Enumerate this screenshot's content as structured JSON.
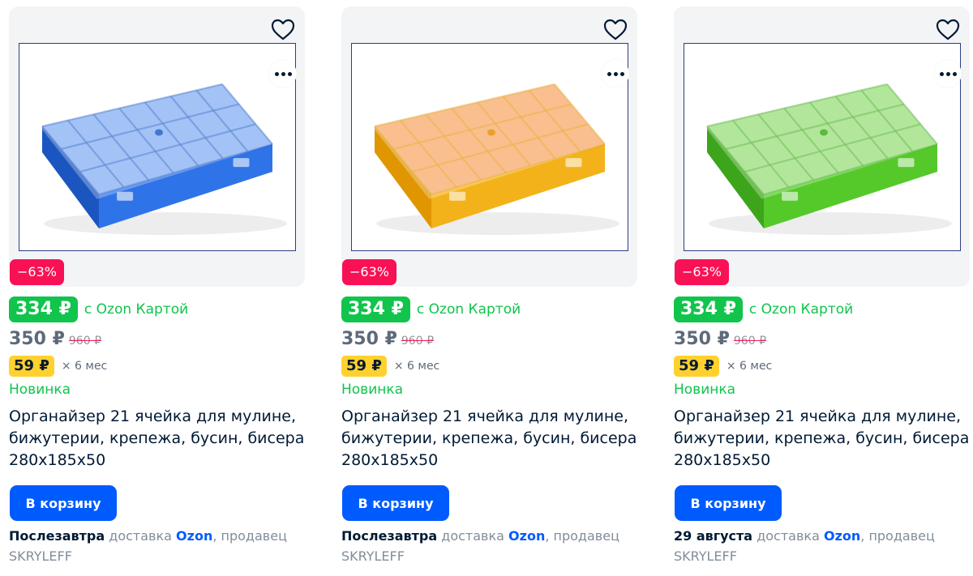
{
  "products": [
    {
      "color": "#2f73e8",
      "color_light": "#79a8f3",
      "color_dark": "#1b55bf",
      "discount": "−63%",
      "card_price": "334 ₽",
      "card_label": "с Ozon Картой",
      "price": "350 ₽",
      "old_price": "960 ₽",
      "installment": "59 ₽",
      "months": "× 6 мес",
      "badge_new": "Новинка",
      "title": "Органайзер 21 ячейка для мулине, бижутерии, крепежа, бусин, бисера 280х185х50",
      "cart_button": "В корзину",
      "delivery_day": "Послезавтра",
      "delivery_text": "доставка",
      "delivery_brand": "Ozon",
      "seller_text": ", продавец",
      "seller": "SKRYLEFF",
      "icons": {
        "favorite": "heart-icon",
        "more": "more-dots-icon"
      }
    },
    {
      "color": "#f4b21a",
      "color_light": "#f9a15a",
      "color_dark": "#e09600",
      "discount": "−63%",
      "card_price": "334 ₽",
      "card_label": "с Ozon Картой",
      "price": "350 ₽",
      "old_price": "960 ₽",
      "installment": "59 ₽",
      "months": "× 6 мес",
      "badge_new": "Новинка",
      "title": "Органайзер 21 ячейка для мулине, бижутерии, крепежа, бусин, бисера 280х185х50",
      "cart_button": "В корзину",
      "delivery_day": "Послезавтра",
      "delivery_text": "доставка",
      "delivery_brand": "Ozon",
      "seller_text": ", продавец",
      "seller": "SKRYLEFF",
      "icons": {
        "favorite": "heart-icon",
        "more": "more-dots-icon"
      }
    },
    {
      "color": "#55c92a",
      "color_light": "#8fdc6e",
      "color_dark": "#3da51b",
      "discount": "−63%",
      "card_price": "334 ₽",
      "card_label": "с Ozon Картой",
      "price": "350 ₽",
      "old_price": "960 ₽",
      "installment": "59 ₽",
      "months": "× 6 мес",
      "badge_new": "Новинка",
      "title": "Органайзер 21 ячейка для мулине, бижутерии, крепежа, бусин, бисера 280х185х50",
      "cart_button": "В корзину",
      "delivery_day": "29 августа",
      "delivery_text": "доставка",
      "delivery_brand": "Ozon",
      "seller_text": ", продавец",
      "seller": "SKRYLEFF",
      "icons": {
        "favorite": "heart-icon",
        "more": "more-dots-icon"
      }
    }
  ],
  "colors": {
    "accent": "#005bff",
    "discount": "#f91155",
    "ozon_card": "#10c44c",
    "installment": "#ffd12f"
  }
}
